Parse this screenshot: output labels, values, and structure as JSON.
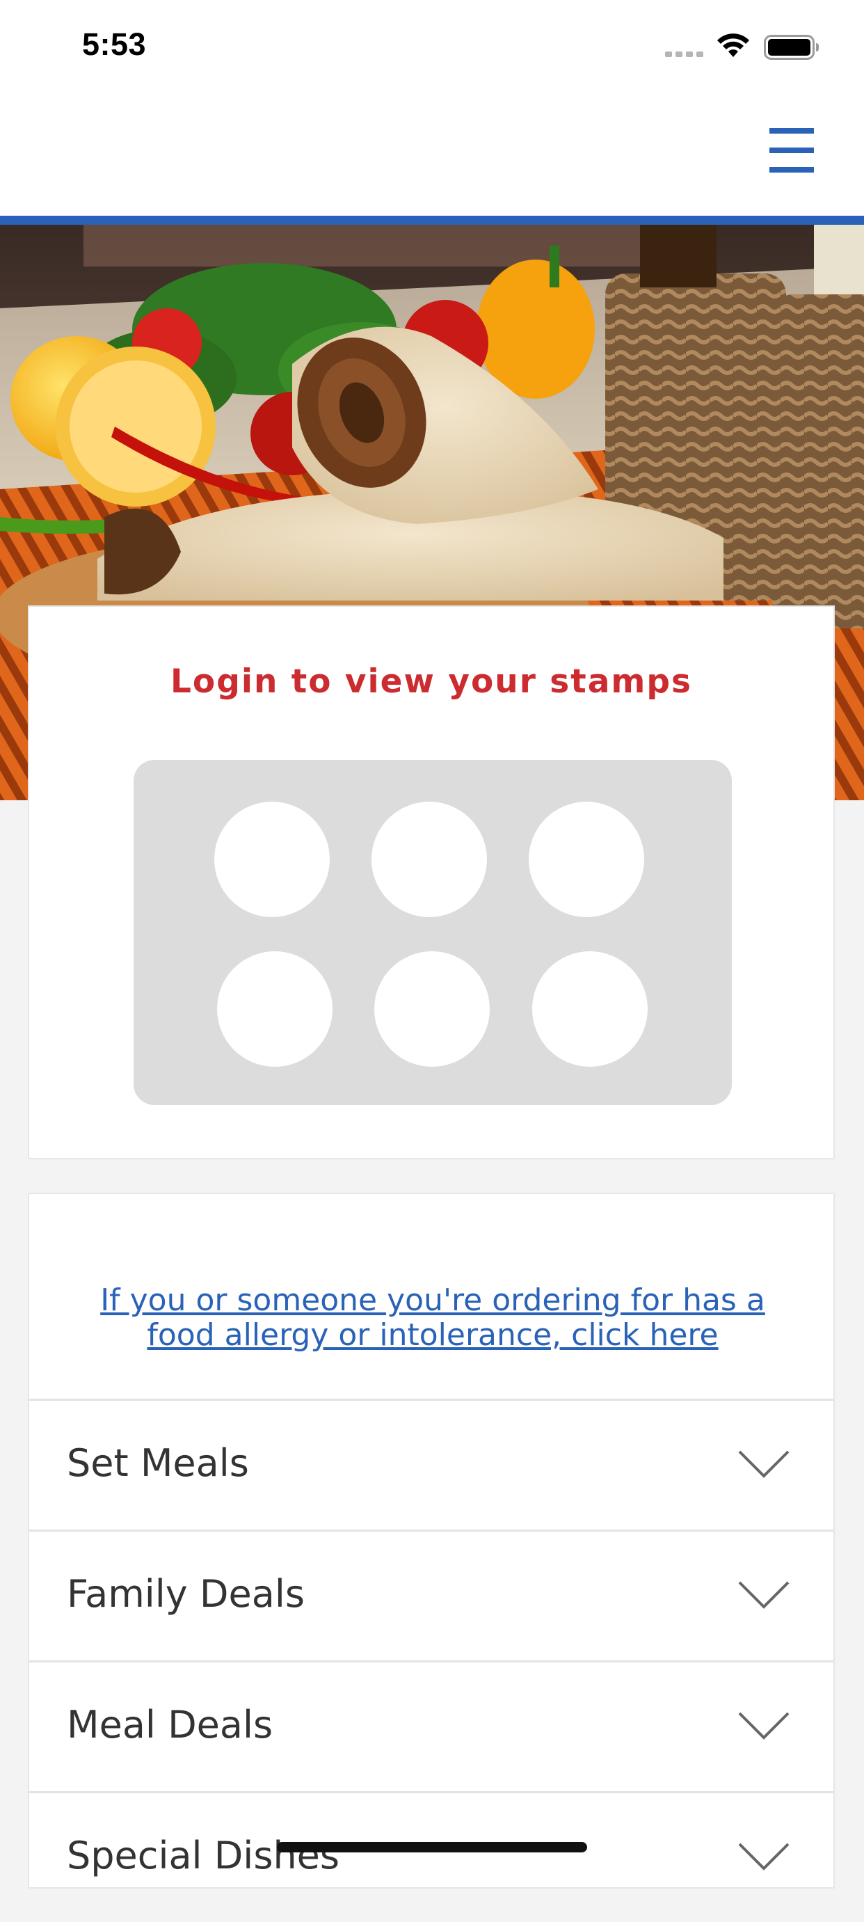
{
  "status_bar": {
    "time": "5:53",
    "icons": [
      "cellular-signal-icon",
      "wifi-icon",
      "battery-icon"
    ]
  },
  "header": {
    "menu_icon": "hamburger-menu-icon",
    "accent_color": "#2962b7"
  },
  "hero": {
    "image": "doner-kebab-wrap-photo"
  },
  "stamps": {
    "title": "Login to view your stamps",
    "title_color": "#cc2b2f",
    "slot_count": 6
  },
  "menu": {
    "allergy_link": "If you or someone you're ordering for has a food allergy or intolerance, click here",
    "categories": [
      {
        "label": "Set Meals"
      },
      {
        "label": "Family Deals"
      },
      {
        "label": "Meal Deals"
      },
      {
        "label": "Special Dishes"
      }
    ]
  }
}
